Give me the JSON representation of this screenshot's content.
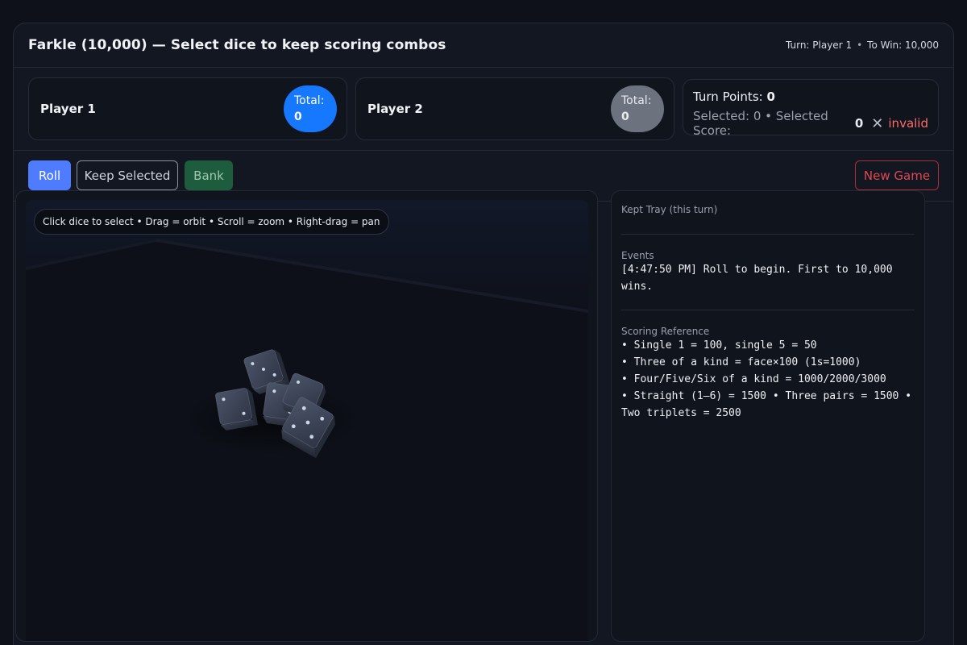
{
  "header": {
    "title": "Farkle (10,000) — Select dice to keep scoring combos",
    "turn": "Turn: Player 1",
    "separator": "•",
    "to_win": "To Win: 10,000"
  },
  "players": [
    {
      "name": "Player 1",
      "total_label": "Total:",
      "total_value": "0",
      "active": true,
      "color": "#1677ff"
    },
    {
      "name": "Player 2",
      "total_label": "Total:",
      "total_value": "0",
      "active": false,
      "color": "#6c727e"
    }
  ],
  "turn_card": {
    "points_label": "Turn Points:",
    "points_value": "0",
    "selected_text": "Selected: 0 • Selected Score:",
    "selected_score": "0",
    "validity_icon": "close-icon",
    "validity": "invalid",
    "validity_color": "#ff6b6b"
  },
  "controls": {
    "roll": "Roll",
    "keep": "Keep Selected",
    "bank": "Bank",
    "new_game": "New Game"
  },
  "stage": {
    "hint": "Click dice to select • Drag = orbit • Scroll = zoom • Right-drag = pan",
    "dice": [
      {
        "face": 3
      },
      {
        "face": 2
      },
      {
        "face": 2
      },
      {
        "face": 2
      },
      {
        "face": 5
      }
    ]
  },
  "side": {
    "kept_label": "Kept Tray (this turn)",
    "events_label": "Events",
    "events": [
      "[4:47:50 PM] Roll to begin. First to 10,000 wins."
    ],
    "reference_label": "Scoring Reference",
    "reference": [
      "• Single 1 = 100, single 5 = 50",
      "• Three of a kind = face×100 (1s=1000)",
      "• Four/Five/Six of a kind = 1000/2000/3000",
      "• Straight (1–6) = 1500 • Three pairs = 1500 • Two triplets = 2500"
    ]
  },
  "colors": {
    "accent": "#4f7cff",
    "bank": "#1d5c3c",
    "danger": "#e0474f"
  }
}
